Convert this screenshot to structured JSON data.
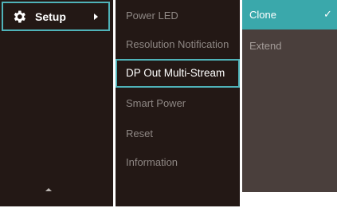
{
  "menu": {
    "category": {
      "label": "Setup",
      "icon": "gear-icon"
    },
    "submenu": [
      {
        "label": "Power LED",
        "selected": false
      },
      {
        "label": "Resolution Notification",
        "selected": false
      },
      {
        "label": "DP Out Multi-Stream",
        "selected": true
      },
      {
        "label": "Smart Power",
        "selected": false
      },
      {
        "label": "Reset",
        "selected": false
      },
      {
        "label": "Information",
        "selected": false
      }
    ],
    "options": [
      {
        "label": "Clone",
        "checked": true,
        "check_glyph": "✓"
      },
      {
        "label": "Extend",
        "checked": false
      }
    ]
  },
  "colors": {
    "panel_bg": "#231815",
    "accent": "#4fb3b9",
    "option_active_bg": "#3aa8ab",
    "option_panel_bg": "#4a3f3c",
    "muted_text": "#8e8784"
  }
}
